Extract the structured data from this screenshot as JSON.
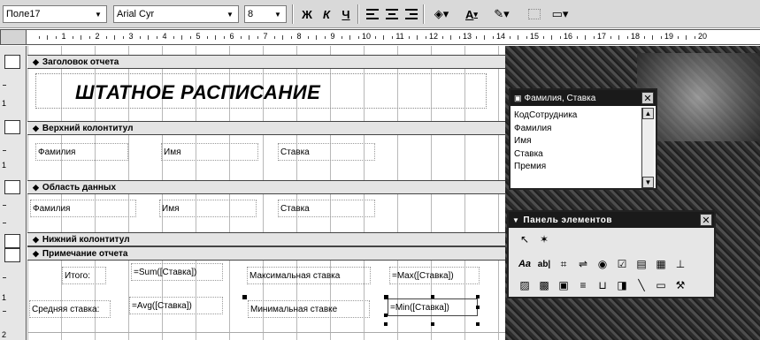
{
  "toolbar": {
    "object_combo": "Поле17",
    "font_combo": "Arial Cyr",
    "size_combo": "8",
    "bold_label": "Ж",
    "italic_label": "К",
    "underline_label": "Ч",
    "fill_color_icon": "paint-bucket-icon",
    "font_color_label": "A"
  },
  "ruler": {
    "numbers": [
      "1",
      "2",
      "3",
      "4",
      "5",
      "6",
      "7",
      "8",
      "9",
      "10",
      "11",
      "12",
      "13",
      "14",
      "15",
      "16",
      "17",
      "18",
      "19",
      "20"
    ]
  },
  "vertical_ruler": {
    "numbers": [
      "1",
      "1",
      "1",
      "1",
      "2"
    ]
  },
  "sections": {
    "report_header": "Заголовок отчета",
    "page_header": "Верхний колонтитул",
    "detail": "Область данных",
    "page_footer": "Нижний колонтитул",
    "report_footer": "Примечание отчета"
  },
  "report": {
    "title": "ШТАТНОЕ РАСПИСАНИЕ",
    "header_labels": [
      "Фамилия",
      "Имя",
      "Ставка"
    ],
    "detail_fields": [
      "Фамилия",
      "Имя",
      "Ставка"
    ],
    "footer": {
      "total_label": "Итого:",
      "total_expr": "=Sum([Ставка])",
      "max_label": "Максимальная ставка",
      "max_expr": "=Max([Ставка])",
      "avg_label": "Средняя ставка:",
      "avg_expr": "=Avg([Ставка])",
      "min_label": "Минимальная ставке",
      "min_expr": "=Min([Ставка])"
    }
  },
  "field_list": {
    "title": "Фамилия, Ставка",
    "items": [
      "КодСотрудника",
      "Фамилия",
      "Имя",
      "Ставка",
      "Премия"
    ]
  },
  "toolbox": {
    "title": "Панель элементов"
  }
}
